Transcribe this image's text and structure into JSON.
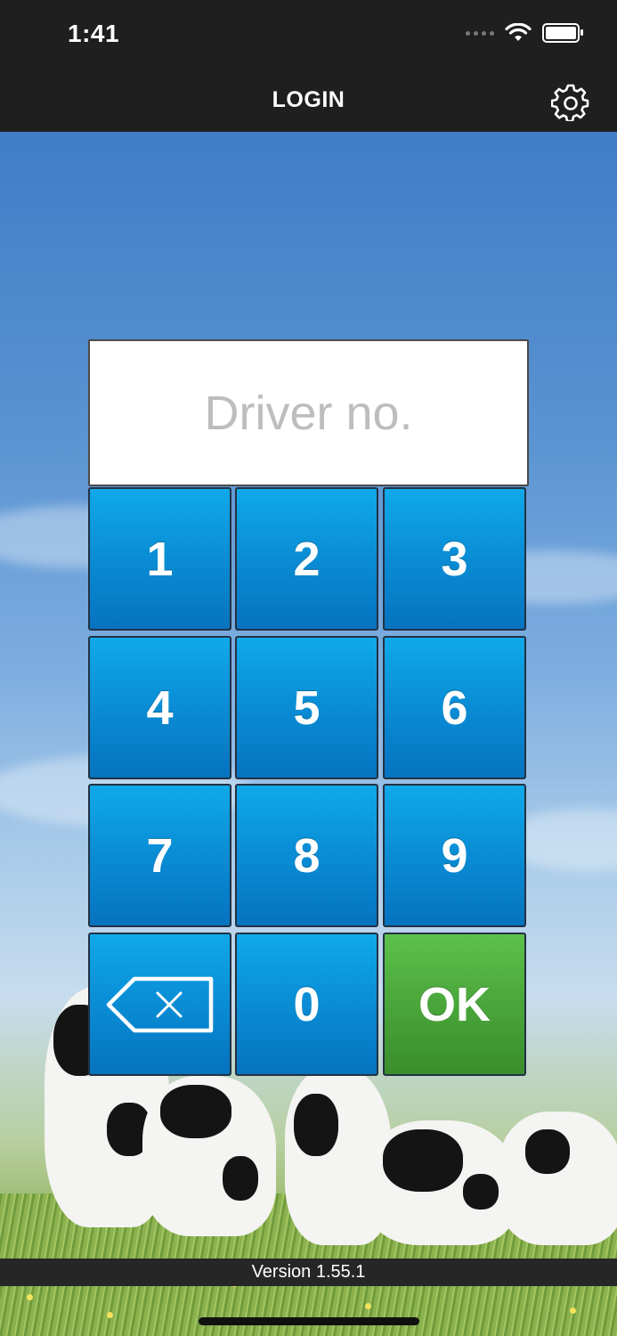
{
  "status_bar": {
    "time": "1:41",
    "icons": [
      "cellular-signal-icon",
      "wifi-icon",
      "battery-icon"
    ]
  },
  "nav": {
    "title": "LOGIN",
    "settings_icon": "gear-icon"
  },
  "login": {
    "driver_input": {
      "placeholder": "Driver no.",
      "value": ""
    }
  },
  "keypad": {
    "keys": [
      "1",
      "2",
      "3",
      "4",
      "5",
      "6",
      "7",
      "8",
      "9"
    ],
    "zero": "0",
    "ok": "OK",
    "backspace_icon": "backspace-icon"
  },
  "footer": {
    "version": "Version 1.55.1"
  },
  "colors": {
    "key_blue": "#0a8fd7",
    "ok_green": "#4aa63a",
    "bar_dark": "#1f1f1f"
  }
}
